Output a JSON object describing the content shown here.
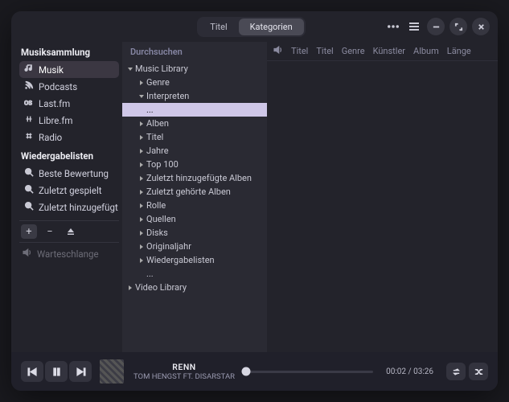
{
  "titlebar": {
    "tabs": {
      "title": "Titel",
      "categories": "Kategorien"
    }
  },
  "sidebar": {
    "collection_header": "Musiksammlung",
    "collection": [
      {
        "id": "music",
        "label": "Musik",
        "icon": "music-note-icon",
        "selected": true
      },
      {
        "id": "podcasts",
        "label": "Podcasts",
        "icon": "rss-icon"
      },
      {
        "id": "lastfm",
        "label": "Last.fm",
        "icon": "lastfm-icon"
      },
      {
        "id": "librefm",
        "label": "Libre.fm",
        "icon": "librefm-icon"
      },
      {
        "id": "radio",
        "label": "Radio",
        "icon": "radio-icon"
      }
    ],
    "playlists_header": "Wiedergabelisten",
    "playlists": [
      {
        "id": "best",
        "label": "Beste Bewertung",
        "icon": "search-icon"
      },
      {
        "id": "recent",
        "label": "Zuletzt gespielt",
        "icon": "search-icon"
      },
      {
        "id": "added",
        "label": "Zuletzt hinzugefügt",
        "icon": "search-icon"
      }
    ],
    "queue_label": "Warteschlange"
  },
  "browse": {
    "header": "Durchsuchen",
    "tree": [
      {
        "label": "Music Library",
        "depth": 0,
        "expanded": true
      },
      {
        "label": "Genre",
        "depth": 1
      },
      {
        "label": "Interpreten",
        "depth": 1,
        "expanded": true
      },
      {
        "label": "...",
        "depth": 1,
        "noarrow": true,
        "selected": true
      },
      {
        "label": "Alben",
        "depth": 1
      },
      {
        "label": "Titel",
        "depth": 1
      },
      {
        "label": "Jahre",
        "depth": 1
      },
      {
        "label": "Top 100",
        "depth": 1
      },
      {
        "label": "Zuletzt hinzugefügte Alben",
        "depth": 1
      },
      {
        "label": "Zuletzt gehörte Alben",
        "depth": 1
      },
      {
        "label": "Rolle",
        "depth": 1
      },
      {
        "label": "Quellen",
        "depth": 1
      },
      {
        "label": "Disks",
        "depth": 1
      },
      {
        "label": "Originaljahr",
        "depth": 1
      },
      {
        "label": "Wiedergabelisten",
        "depth": 1
      },
      {
        "label": "...",
        "depth": 1,
        "noarrow": true
      },
      {
        "label": "Video Library",
        "depth": 0
      }
    ]
  },
  "columns": [
    "Titel",
    "Titel",
    "Genre",
    "Künstler",
    "Album",
    "Länge"
  ],
  "player": {
    "track_title": "RENN",
    "track_artist": "TOM HENGST FT. DISARSTAR",
    "time_elapsed": "00:02",
    "time_total": "03:26",
    "time_sep": " / "
  }
}
